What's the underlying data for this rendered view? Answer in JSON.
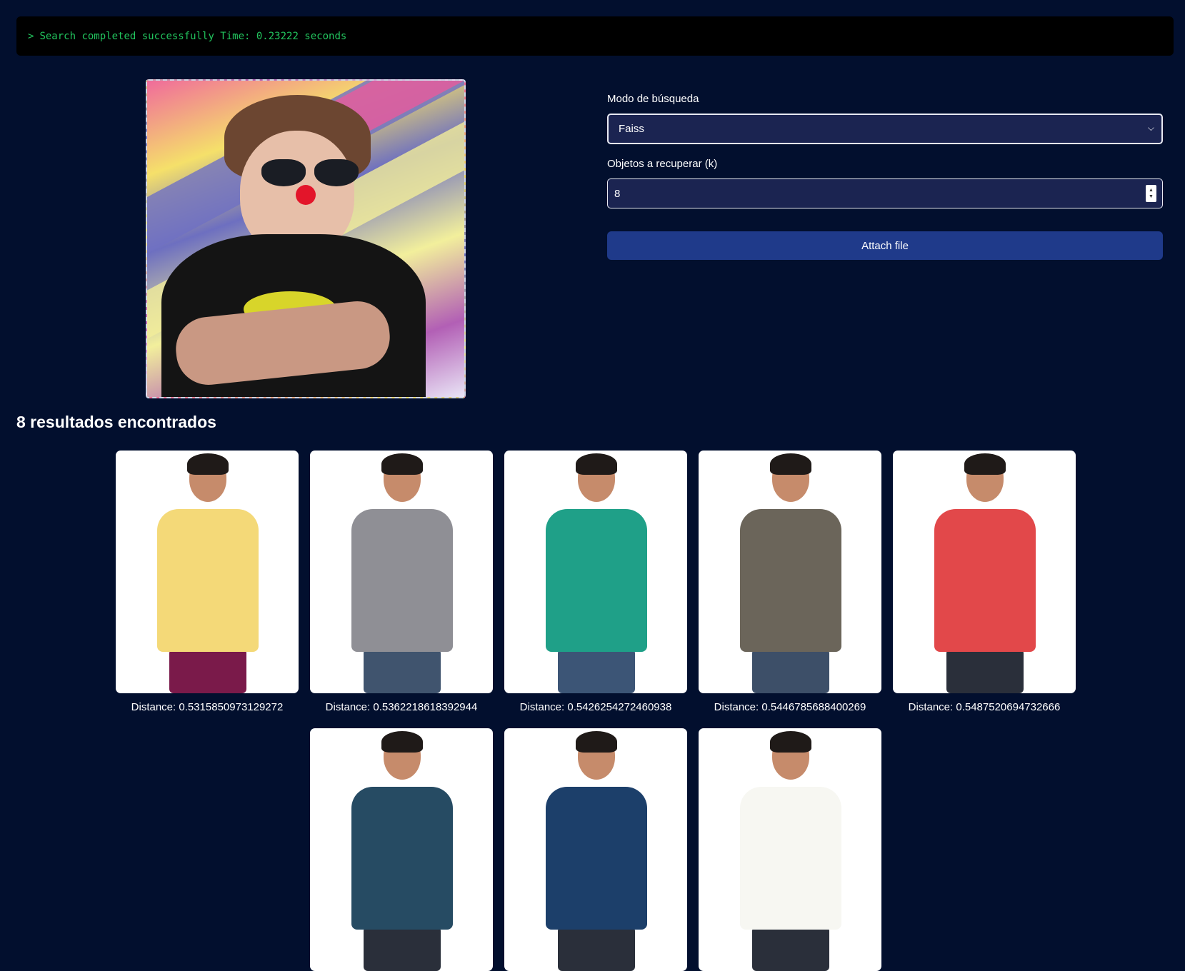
{
  "console": {
    "prompt": ">",
    "message": "Search completed successfully Time: 0.23222 seconds"
  },
  "form": {
    "mode_label": "Modo de búsqueda",
    "mode_value": "Faiss",
    "k_label": "Objetos a recuperar (k)",
    "k_value": "8",
    "attach_label": "Attach file"
  },
  "results": {
    "title": "8 resultados encontrados",
    "items": [
      {
        "caption": "Distance: 0.5315850973129272",
        "shirt_color": "#f4d978",
        "pants_color": "#7a1a4a"
      },
      {
        "caption": "Distance: 0.5362218618392944",
        "shirt_color": "#8f8f95",
        "pants_color": "#40546e"
      },
      {
        "caption": "Distance: 0.5426254272460938",
        "shirt_color": "#1fa088",
        "pants_color": "#3c5576"
      },
      {
        "caption": "Distance: 0.5446785688400269",
        "shirt_color": "#6b655a",
        "pants_color": "#3d4f68"
      },
      {
        "caption": "Distance: 0.5487520694732666",
        "shirt_color": "#e2484a",
        "pants_color": "#2a2f3a"
      },
      {
        "caption": "",
        "shirt_color": "#264b63",
        "pants_color": "#2a2f3a"
      },
      {
        "caption": "",
        "shirt_color": "#1c3f6a",
        "pants_color": "#2a2f3a"
      },
      {
        "caption": "",
        "shirt_color": "#f7f7f2",
        "pants_color": "#2a2f3a"
      }
    ]
  }
}
